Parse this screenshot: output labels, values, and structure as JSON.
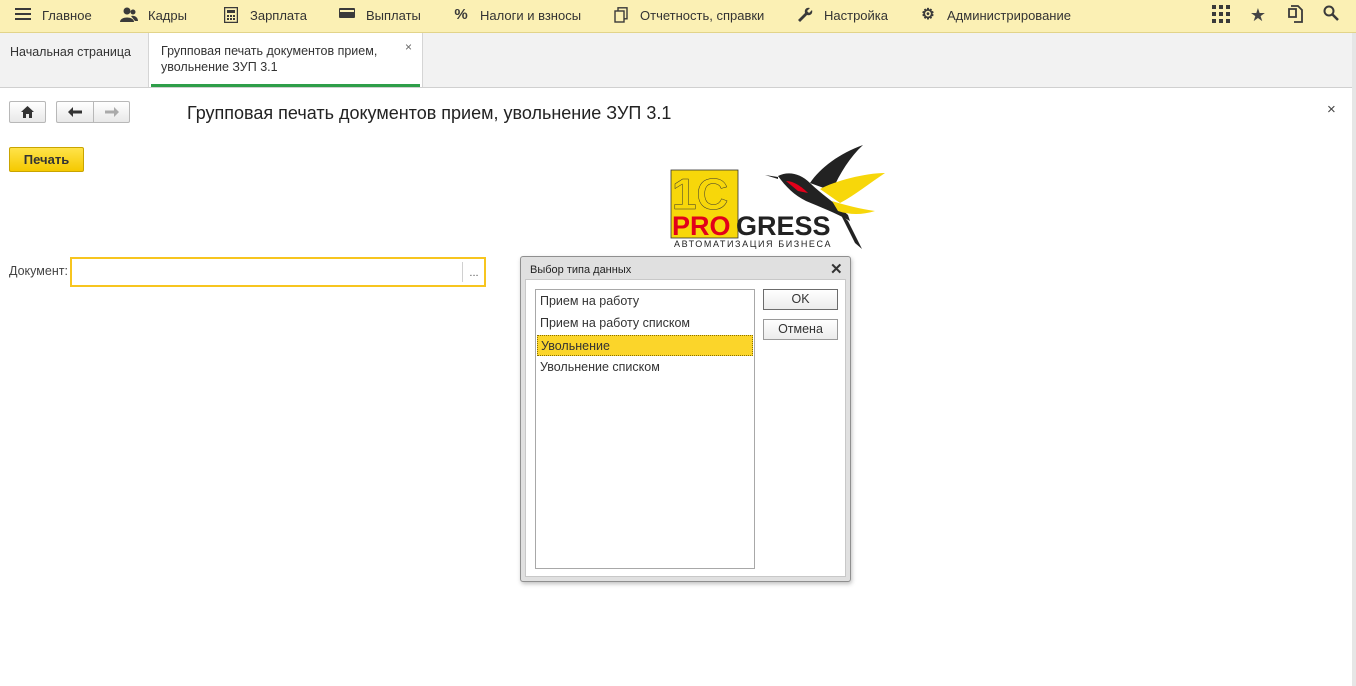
{
  "topbar": {
    "items": [
      {
        "label": "Главное",
        "icon": "hamburger-icon"
      },
      {
        "label": "Кадры",
        "icon": "people-icon"
      },
      {
        "label": "Зарплата",
        "icon": "calculator-icon"
      },
      {
        "label": "Выплаты",
        "icon": "wallet-icon"
      },
      {
        "label": "Налоги и взносы",
        "icon": "percent-icon"
      },
      {
        "label": "Отчетность, справки",
        "icon": "documents-icon"
      },
      {
        "label": "Настройка",
        "icon": "wrench-icon"
      },
      {
        "label": "Администрирование",
        "icon": "gear-icon"
      }
    ],
    "right_icons": [
      "grid-icon",
      "star-icon",
      "history-icon",
      "search-icon"
    ]
  },
  "tabs": {
    "home": "Начальная страница",
    "active_line1": "Групповая печать документов прием,",
    "active_line2": "увольнение ЗУП 3.1",
    "close": "×"
  },
  "page": {
    "title": "Групповая печать документов прием, увольнение ЗУП 3.1",
    "close": "×",
    "print_label": "Печать",
    "document_label": "Документ:",
    "document_value": "",
    "choose_label": "..."
  },
  "logo": {
    "top": "1C",
    "pro": "PRO",
    "gress": "GRESS",
    "tagline": "АВТОМАТИЗАЦИЯ БИЗНЕСА"
  },
  "dialog": {
    "title": "Выбор типа данных",
    "close": "✕",
    "items": [
      "Прием на работу",
      "Прием на работу списком",
      "Увольнение",
      "Увольнение списком"
    ],
    "selected_index": 2,
    "ok_label": "OK",
    "cancel_label": "Отмена"
  },
  "colors": {
    "topbar_bg": "#fbf0b4",
    "accent_yellow": "#f7c51f",
    "tab_underline": "#2e9e49",
    "logo_red": "#e2001a"
  }
}
